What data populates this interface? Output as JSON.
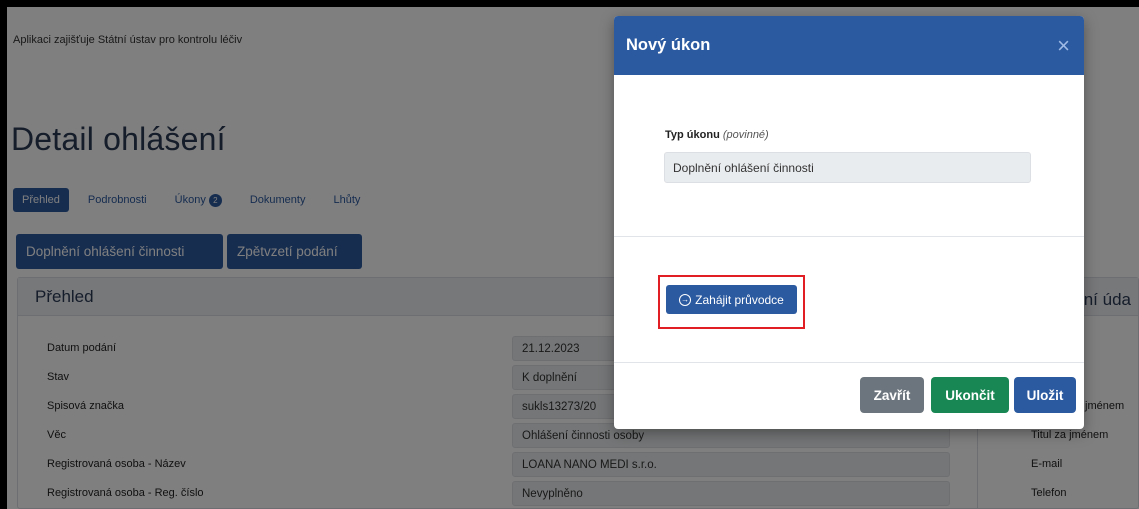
{
  "header": {
    "note": "Aplikaci zajišťuje Státní ústav pro kontrolu léčiv"
  },
  "page": {
    "title": "Detail ohlášení"
  },
  "tabs": [
    {
      "label": "Přehled",
      "active": true
    },
    {
      "label": "Podrobnosti"
    },
    {
      "label": "Úkony",
      "badge": "2"
    },
    {
      "label": "Dokumenty"
    },
    {
      "label": "Lhůty"
    }
  ],
  "actions": {
    "supplement_label": "Doplnění ohlášení činnosti",
    "withdraw_label": "Zpětvzetí podání"
  },
  "overview": {
    "title": "Přehled",
    "rows": [
      {
        "label": "Datum podání",
        "value": "21.12.2023"
      },
      {
        "label": "Stav",
        "value": "K doplnění"
      },
      {
        "label": "Spisová značka",
        "value": "sukls13273/20"
      },
      {
        "label": "Věc",
        "value": "Ohlášení činnosti osoby"
      },
      {
        "label": "Registrovaná osoba - Název",
        "value": "LOANA NANO MEDI s.r.o."
      },
      {
        "label": "Registrovaná osoba - Reg. číslo",
        "value": "Nevyplněno"
      }
    ]
  },
  "side_panel": {
    "title_fragment": "tní úda",
    "labels": [
      "jménem",
      "Titul za jménem",
      "E-mail",
      "Telefon"
    ]
  },
  "modal": {
    "title": "Nový úkon",
    "close_glyph": "×",
    "field_label": "Typ úkonu",
    "field_hint": "(povinné)",
    "field_value": "Doplnění ohlášení činnosti",
    "wizard_label": "Zahájit průvodce",
    "wizard_icon_glyph": "→",
    "buttons": {
      "close": "Zavřít",
      "finish": "Ukončit",
      "save": "Uložit"
    }
  },
  "colors": {
    "primary": "#2c5aa0",
    "success": "#198754",
    "secondary": "#6c757d",
    "highlight": "#e01e24"
  }
}
